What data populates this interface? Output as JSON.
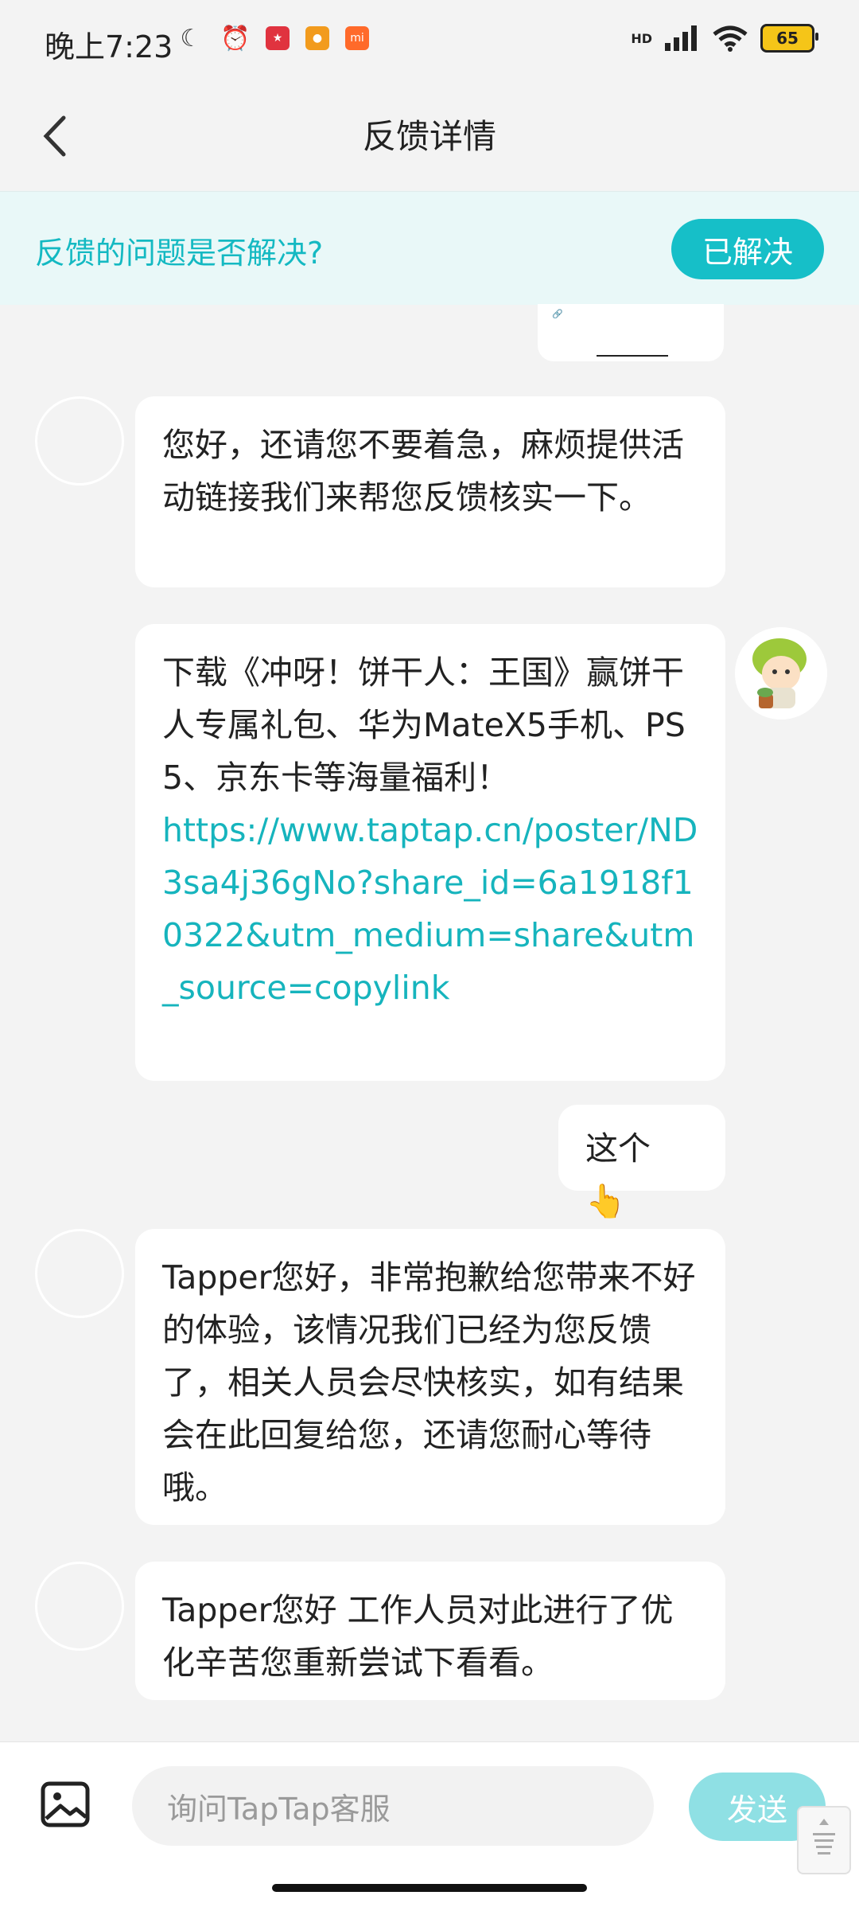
{
  "status_bar": {
    "time": "晚上7:23",
    "hd_label": "HD",
    "battery": "65",
    "left_icons": [
      "moon-icon",
      "alarm-icon",
      "app-icon-red",
      "weibo-icon",
      "mi-icon"
    ]
  },
  "header": {
    "title": "反馈详情"
  },
  "banner": {
    "question": "反馈的问题是否解决?",
    "resolved_label": "已解决"
  },
  "messages": [
    {
      "side": "left",
      "text": "您好，还请您不要着急，麻烦提供活动链接我们来帮您反馈核实一下。"
    },
    {
      "side": "left",
      "text": "下载《冲呀！饼干人：王国》赢饼干人专属礼包、华为MateX5手机、PS5、京东卡等海量福利！",
      "link": "https://www.taptap.cn/poster/ND3sa4j36gNo?share_id=6a1918f10322&utm_medium=share&utm_source=copylink"
    },
    {
      "side": "right",
      "text": "这个",
      "emoji": "👆"
    },
    {
      "side": "left",
      "text": "Tapper您好，非常抱歉给您带来不好的体验，该情况我们已经为您反馈了，相关人员会尽快核实，如有结果会在此回复给您，还请您耐心等待哦。"
    },
    {
      "side": "left",
      "text": "Tapper您好 工作人员对此进行了优化辛苦您重新尝试下看看。"
    }
  ],
  "input": {
    "placeholder": "询问TapTap客服",
    "send_label": "发送"
  },
  "colors": {
    "accent": "#16bfc8",
    "link": "#16b4bd",
    "banner_bg": "#e9f8f8",
    "page_bg": "#f3f3f3"
  }
}
